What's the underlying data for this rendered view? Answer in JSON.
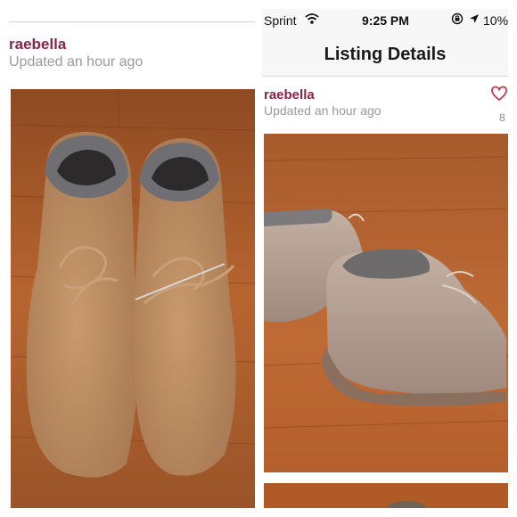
{
  "left_panel": {
    "username": "raebella",
    "updated": "Updated an hour ago"
  },
  "right_panel": {
    "status_bar": {
      "carrier": "Sprint",
      "time": "9:25 PM",
      "battery": "10%"
    },
    "nav_title": "Listing Details",
    "username": "raebella",
    "updated": "Updated an hour ago",
    "like_count": "8"
  },
  "icons": {
    "wifi": "wifi-icon",
    "lock_rotation": "rotation-lock-icon",
    "location": "location-arrow-icon",
    "heart": "heart-icon"
  },
  "colors": {
    "username": "#8b2447",
    "heart": "#c43a4a",
    "floor": "#a65a2e"
  }
}
